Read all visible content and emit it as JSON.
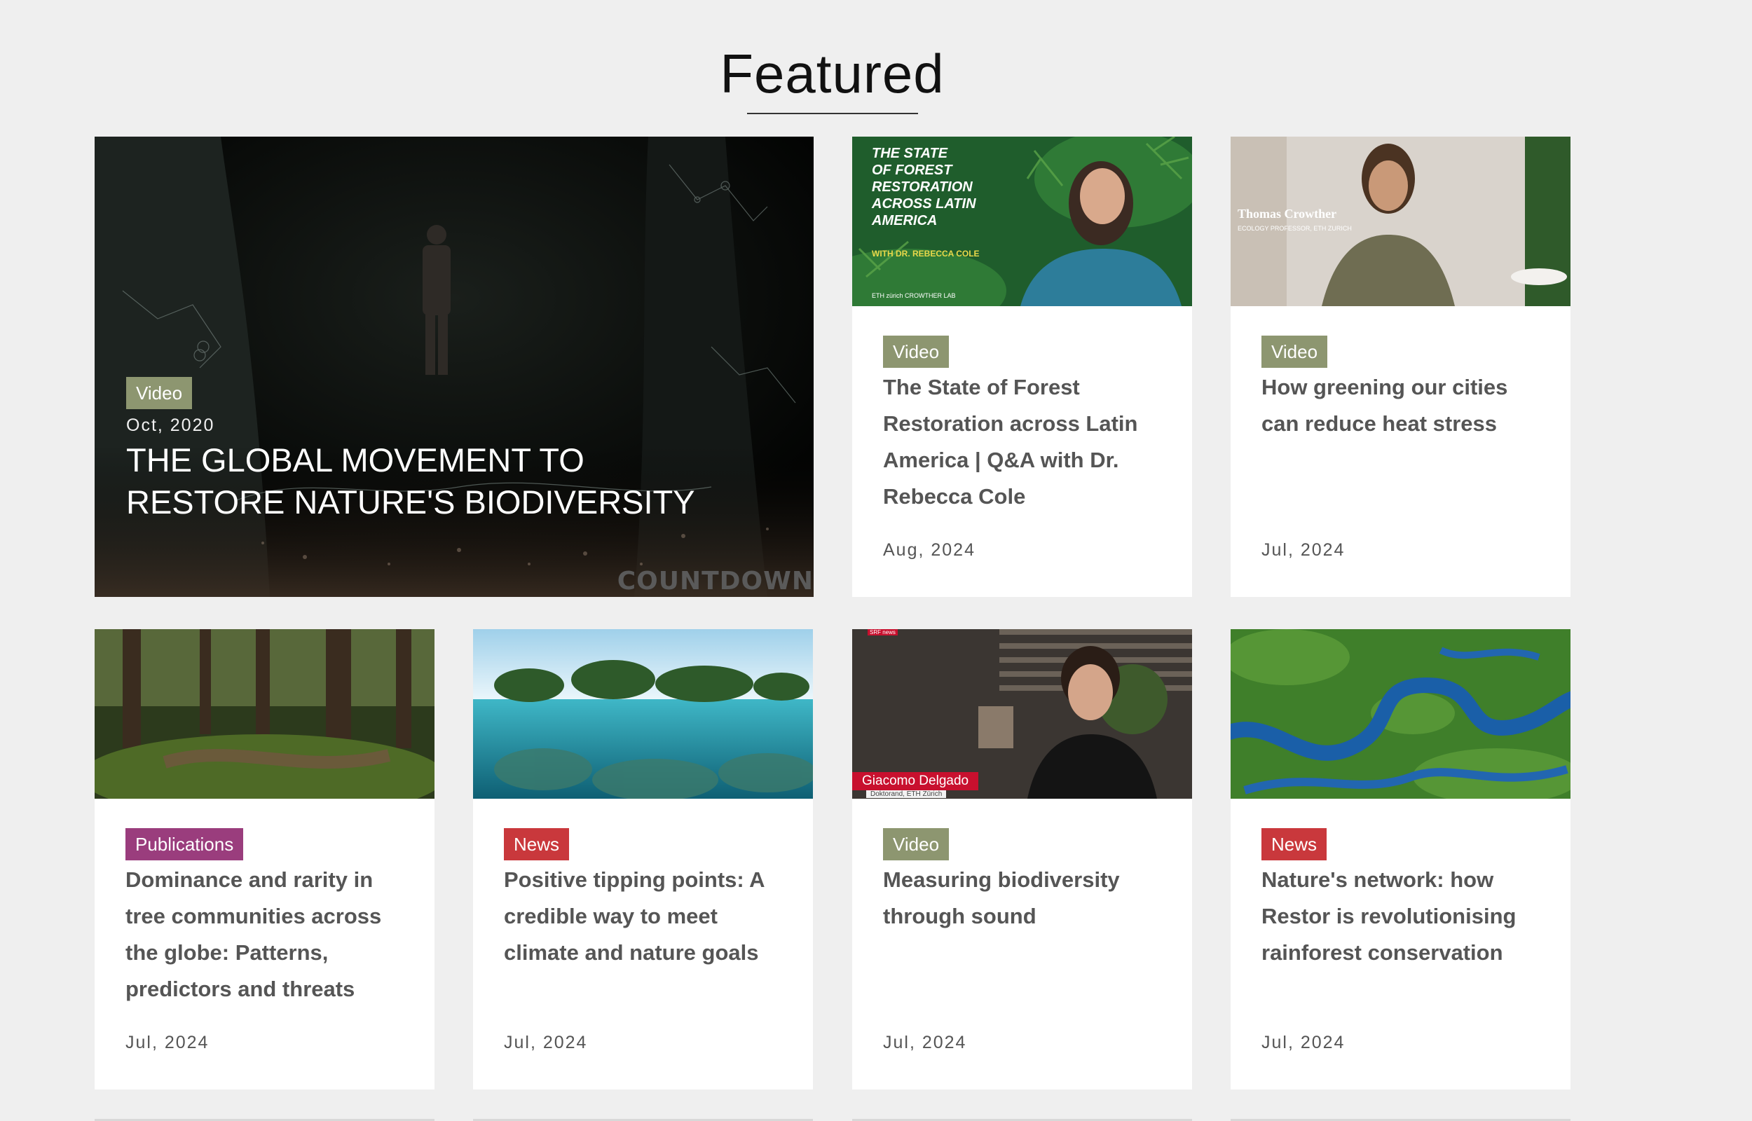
{
  "section": {
    "title": "Featured"
  },
  "hero": {
    "badge": "Video",
    "date": "Oct, 2020",
    "title": "THE GLOBAL MOVEMENT TO RESTORE NATURE'S BIODIVERSITY",
    "watermark": "COUNTDOWN"
  },
  "cards": [
    {
      "badge": "Video",
      "title": "The State of Forest Restoration across Latin America | Q&A with Dr. Rebecca Cole",
      "date": "Aug, 2024",
      "thumb": {
        "overlay_title": [
          "THE STATE",
          "OF FOREST",
          "RESTORATION",
          "ACROSS LATIN",
          "AMERICA"
        ],
        "overlay_sub": "WITH DR. REBECCA COLE",
        "overlay_footer": "ETH zürich   CROWTHER LAB"
      }
    },
    {
      "badge": "Video",
      "title": "How greening our cities can reduce heat stress",
      "date": "Jul, 2024",
      "thumb": {
        "name": "Thomas Crowther",
        "role": "ECOLOGY PROFESSOR, ETH ZURICH"
      }
    },
    {
      "badge": "Publications",
      "title": "Dominance and rarity in tree communities across the globe: Patterns, predictors and threats",
      "date": "Jul, 2024"
    },
    {
      "badge": "News",
      "title": "Positive tipping points: A credible way to meet climate and nature goals",
      "date": "Jul, 2024"
    },
    {
      "badge": "Video",
      "title": "Measuring biodiversity through sound",
      "date": "Jul, 2024",
      "thumb": {
        "tag": "SRF news",
        "name": "Giacomo Delgado",
        "role": "Doktorand, ETH Zürich"
      }
    },
    {
      "badge": "News",
      "title": "Nature's network: how Restor is revolutionising rainforest conservation",
      "date": "Jul, 2024"
    }
  ],
  "colors": {
    "background": "#efefef",
    "badge_video": "#8d9670",
    "badge_news": "#c9383c",
    "badge_publications": "#9a3d7d"
  }
}
